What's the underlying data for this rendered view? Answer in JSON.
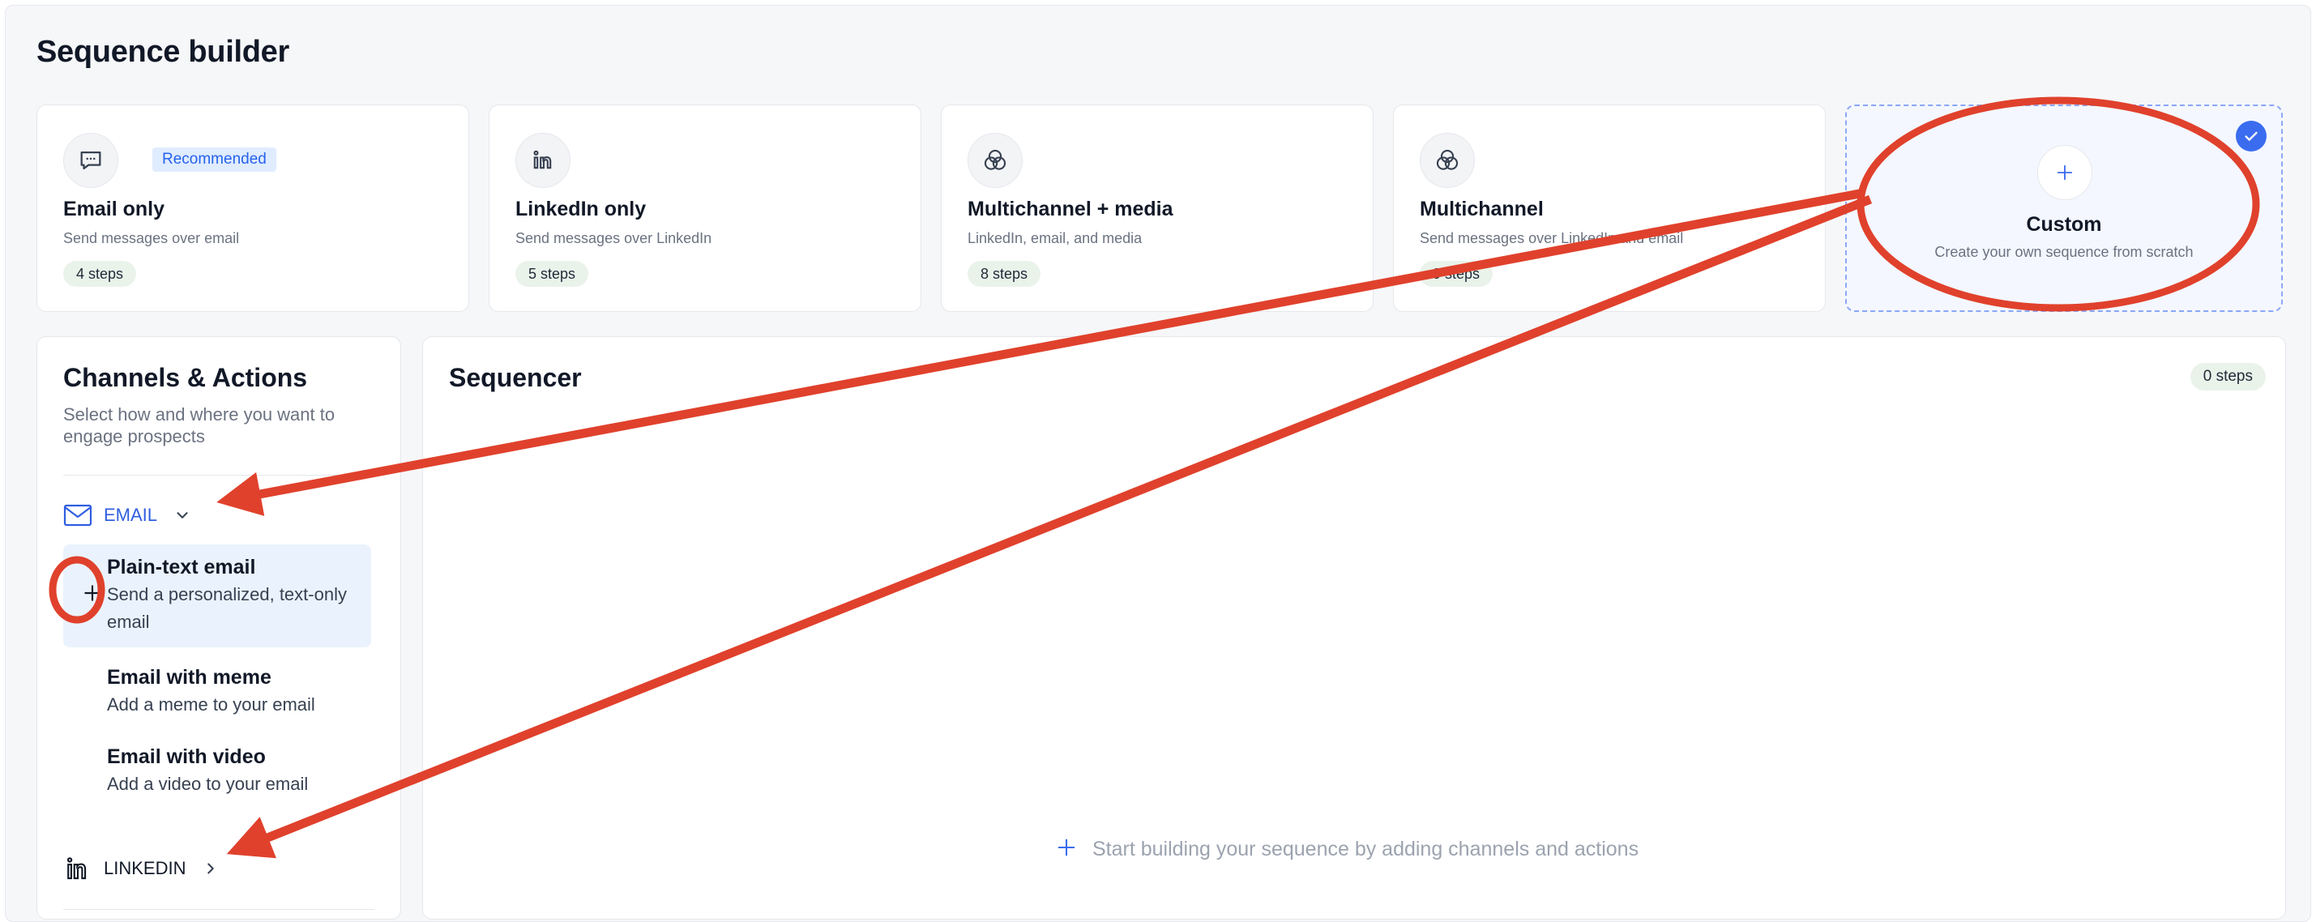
{
  "page": {
    "title": "Sequence builder"
  },
  "templates": [
    {
      "title": "Email only",
      "description": "Send messages over email",
      "steps": "4 steps",
      "badge": "Recommended",
      "icon": "chat-bubble-icon"
    },
    {
      "title": "LinkedIn only",
      "description": "Send messages over LinkedIn",
      "steps": "5 steps",
      "icon": "linkedin-icon"
    },
    {
      "title": "Multichannel + media",
      "description": "LinkedIn, email, and media",
      "steps": "8 steps",
      "icon": "venn-icon"
    },
    {
      "title": "Multichannel",
      "description": "Send messages over LinkedIn and email",
      "steps": "9 steps",
      "icon": "venn-icon"
    },
    {
      "title": "Custom",
      "description": "Create your own sequence from scratch",
      "icon": "plus-icon",
      "selected": true
    }
  ],
  "channels_panel": {
    "title": "Channels & Actions",
    "subtitle": "Select how and where you want to engage prospects",
    "email": {
      "label": "EMAIL",
      "color": "#2f5fe0",
      "actions": [
        {
          "title": "Plain-text email",
          "description": "Send a personalized, text-only email"
        },
        {
          "title": "Email with meme",
          "description": "Add a meme to your email"
        },
        {
          "title": "Email with video",
          "description": "Add a video to your email"
        }
      ]
    },
    "linkedin": {
      "label": "LINKEDIN"
    }
  },
  "sequencer": {
    "title": "Sequencer",
    "steps": "0 steps",
    "empty_text": "Start building your sequence by adding channels and actions"
  },
  "colors": {
    "accent": "#3b6cf0",
    "annotation": "#e0412c",
    "pill": "#eaf3ea"
  }
}
